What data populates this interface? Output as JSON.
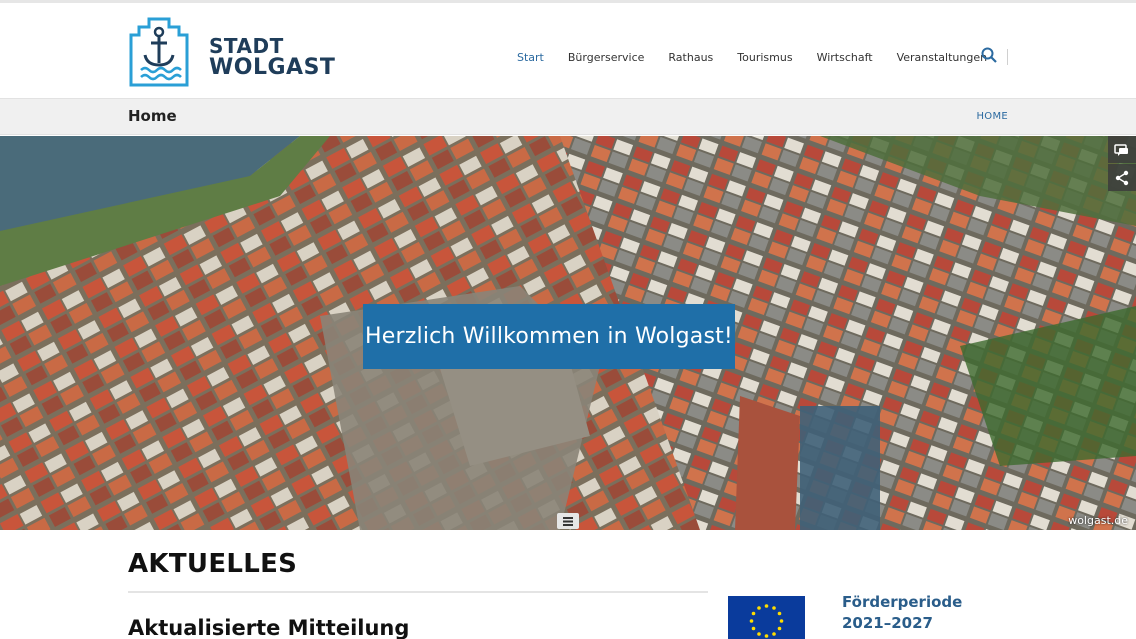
{
  "header": {
    "logo_line1": "STADT",
    "logo_line2": "WOLGAST",
    "nav": [
      "Start",
      "Bürgerservice",
      "Rathaus",
      "Tourismus",
      "Wirtschaft",
      "Veranstaltungen"
    ],
    "active_nav": "Start",
    "search_icon": "search-icon"
  },
  "breadcrumb": {
    "title": "Home",
    "home_link": "HOME"
  },
  "hero": {
    "caption": "Herzlich Willkommen in Wolgast!",
    "credit": "wolgast.de",
    "side_tools": [
      "chat-icon",
      "share-icon"
    ],
    "toggle_icon": "menu-icon"
  },
  "content": {
    "section_title": "AKTUELLES",
    "article_title": "Aktualisierte Mitteilung",
    "sidebar_title": "Förderperiode 2021–2027"
  },
  "colors": {
    "brand": "#1f3d5a",
    "accent": "#2b6aa0",
    "caption_bg": "#1f6fa8",
    "eu_blue": "#0a3b9c",
    "eu_star": "#ffdd00"
  }
}
